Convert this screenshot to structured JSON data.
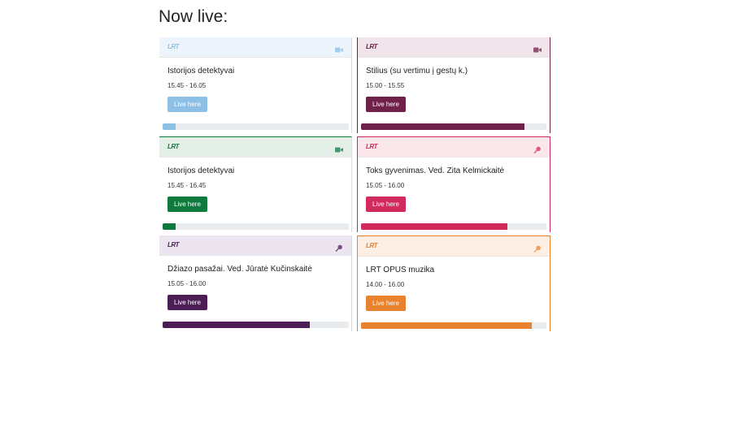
{
  "page": {
    "heading": "Now live:"
  },
  "cards": [
    {
      "logo": "LRT",
      "media_icon": "video-camera-icon",
      "title": "Istorijos detektyvai",
      "time": "15.45 - 16.05",
      "button_label": "Live here",
      "progress": 0.07,
      "color": "#8ec0e6",
      "header_bg": "#edf4fb"
    },
    {
      "logo": "LRT",
      "media_icon": "video-camera-icon",
      "title": "Stilius (su vertimu į gestų k.)",
      "time": "15.00 - 15.55",
      "button_label": "Live here",
      "progress": 0.88,
      "color": "#70214a",
      "header_bg": "#f1e4ea"
    },
    {
      "logo": "LRT",
      "media_icon": "video-camera-icon",
      "title": "Istorijos detektyvai",
      "time": "15.45 - 16.45",
      "button_label": "Live here",
      "progress": 0.07,
      "color": "#0e7a3d",
      "header_bg": "#e3efe7"
    },
    {
      "logo": "LRT",
      "media_icon": "microphone-icon",
      "title": "Toks gyvenimas. Ved. Zita Kelmickaitė",
      "time": "15.05 - 16.00",
      "button_label": "Live here",
      "progress": 0.79,
      "color": "#d12a5c",
      "header_bg": "#fbe6ec"
    },
    {
      "logo": "LRT",
      "media_icon": "microphone-icon",
      "title": "Džiazo pasažai. Ved. Jūratė Kučinskaitė",
      "time": "15.05 - 16.00",
      "button_label": "Live here",
      "progress": 0.79,
      "color": "#4b1f56",
      "header_bg": "#ece4ee"
    },
    {
      "logo": "LRT",
      "media_icon": "microphone-icon",
      "title": "LRT OPUS muzika",
      "time": "14.00 - 16.00",
      "button_label": "Live here",
      "progress": 0.92,
      "color": "#e8822f",
      "header_bg": "#fdefe4"
    }
  ]
}
